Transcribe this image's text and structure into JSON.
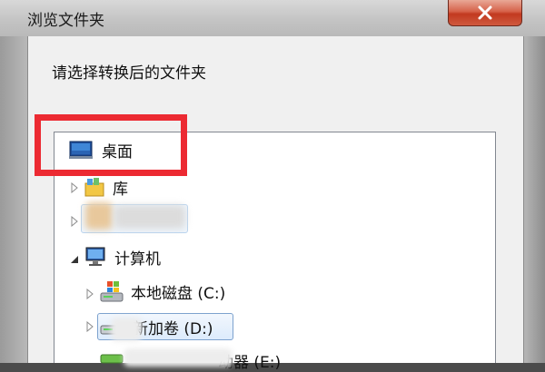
{
  "window": {
    "title": "浏览文件夹"
  },
  "dialog": {
    "instruction": "请选择转换后的文件夹"
  },
  "tree": {
    "desktop": "桌面",
    "library": "库",
    "computer": "计算机",
    "local_disk": "本地磁盘 (C:)",
    "new_volume": "新加卷 (D:)",
    "drive_e": "动器 (E:)"
  },
  "colors": {
    "highlight": "#ec2a32",
    "close": "#c2391f",
    "selection": "#dcebfc"
  }
}
